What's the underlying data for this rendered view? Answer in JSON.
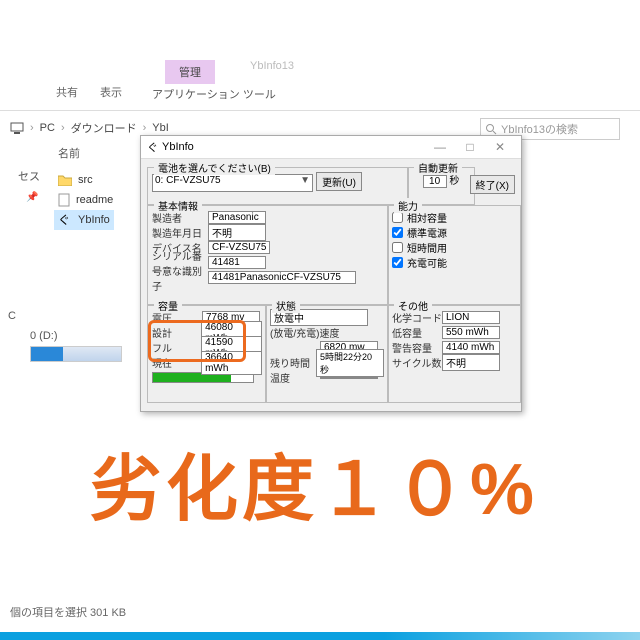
{
  "ribbon": {
    "share": "共有",
    "view": "表示",
    "app_tools": "管理",
    "app_tools_sub": "アプリケーション ツール",
    "faded": "YbInfo13"
  },
  "breadcrumb": {
    "pc": "PC",
    "downloads": "ダウンロード",
    "folder": "YbI"
  },
  "search_placeholder": "YbInfo13の検索",
  "column_header": "名前",
  "side_access": "セス",
  "files": {
    "src": "src",
    "readme": "readme",
    "ybinfo": "YbInfo"
  },
  "category_pc": "C",
  "drive_label": "0 (D:)",
  "footer": "個の項目を選択 301 KB",
  "dlg": {
    "title": "YbInfo",
    "pick_legend": "電池を選んでください(B)",
    "combo": "0: CF-VZSU75",
    "update_btn": "更新(U)",
    "auto_legend": "自動更新",
    "auto_val": "10",
    "auto_unit": "秒",
    "exit": "終了(X)",
    "basic_legend": "基本情報",
    "basic": {
      "mfr_k": "製造者",
      "mfr_v": "Panasonic",
      "date_k": "製造年月日",
      "date_v": "不明",
      "dev_k": "デバイス名",
      "dev_v": "CF-VZSU75",
      "ser_k": "シリアル番号",
      "ser_v": "41481",
      "uid_k": "一意な識別子",
      "uid_v": "41481PanasonicCF-VZSU75"
    },
    "cap_legend": "能力",
    "cap": {
      "rel": "相対容量",
      "std": "標準電源",
      "short": "短時間用",
      "rechg": "充電可能"
    },
    "capL_legend": "容量",
    "capL": {
      "volt_k": "電圧",
      "volt_v": "7768 mv",
      "design_k": "設計",
      "design_v": "46080 mWh",
      "full_k": "フル",
      "full_v": "41590 mWh",
      "now_k": "現在",
      "now_v": "36640 mWh"
    },
    "stat_legend": "状態",
    "stat": {
      "state_k": "放電中",
      "rate_k": "(放電/充電)速度",
      "rate_v": "6820 mw",
      "remain_k": "残り時間",
      "remain_v": "5時間22分20秒",
      "temp_k": "温度"
    },
    "other_legend": "その他",
    "other": {
      "chem_k": "化学コード",
      "chem_v": "LION",
      "low_k": "低容量",
      "low_v": "550 mWh",
      "warn_k": "警告容量",
      "warn_v": "4140 mWh",
      "cycle_k": "サイクル数",
      "cycle_v": "不明"
    }
  },
  "overlay": "劣化度１０%"
}
